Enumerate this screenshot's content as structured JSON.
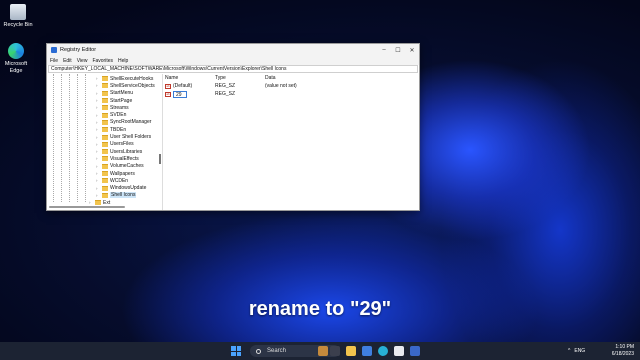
{
  "desktop": {
    "icons": [
      {
        "label": "Recycle Bin",
        "icon": "recycle-bin-icon"
      },
      {
        "label": "Microsoft Edge",
        "icon": "edge-browser-icon"
      }
    ]
  },
  "window": {
    "title": "Registry Editor",
    "controls": {
      "minimize": "–",
      "maximize": "☐",
      "close": "✕"
    },
    "menu": [
      "File",
      "Edit",
      "View",
      "Favorites",
      "Help"
    ],
    "address": "Computer\\HKEY_LOCAL_MACHINE\\SOFTWARE\\Microsoft\\Windows\\CurrentVersion\\Explorer\\Shell Icons",
    "tree": [
      "ShellExecuteHooks",
      "ShellServiceObjects",
      "StartMenu",
      "StartPage",
      "Streams",
      "SVDEn",
      "SyncRootManager",
      "TBDEn",
      "User Shell Folders",
      "UsersFiles",
      "UsersLibraries",
      "VisualEffects",
      "VolumeCaches",
      "Wallpapers",
      "WCDEn",
      "WindowsUpdate",
      "Shell Icons",
      "Ext"
    ],
    "selected_tree_item": "Shell Icons",
    "columns": {
      "name": "Name",
      "type": "Type",
      "data": "Data"
    },
    "values": [
      {
        "name": "(Default)",
        "type": "REG_SZ",
        "data": "(value not set)"
      },
      {
        "name": "29",
        "type": "REG_SZ",
        "data": ""
      }
    ]
  },
  "caption": "rename to \"29\"",
  "taskbar": {
    "search_label": "Search",
    "time": "1:10 PM",
    "date": "6/18/2023",
    "tray_language": "ENG",
    "tray_chevron": "^"
  }
}
